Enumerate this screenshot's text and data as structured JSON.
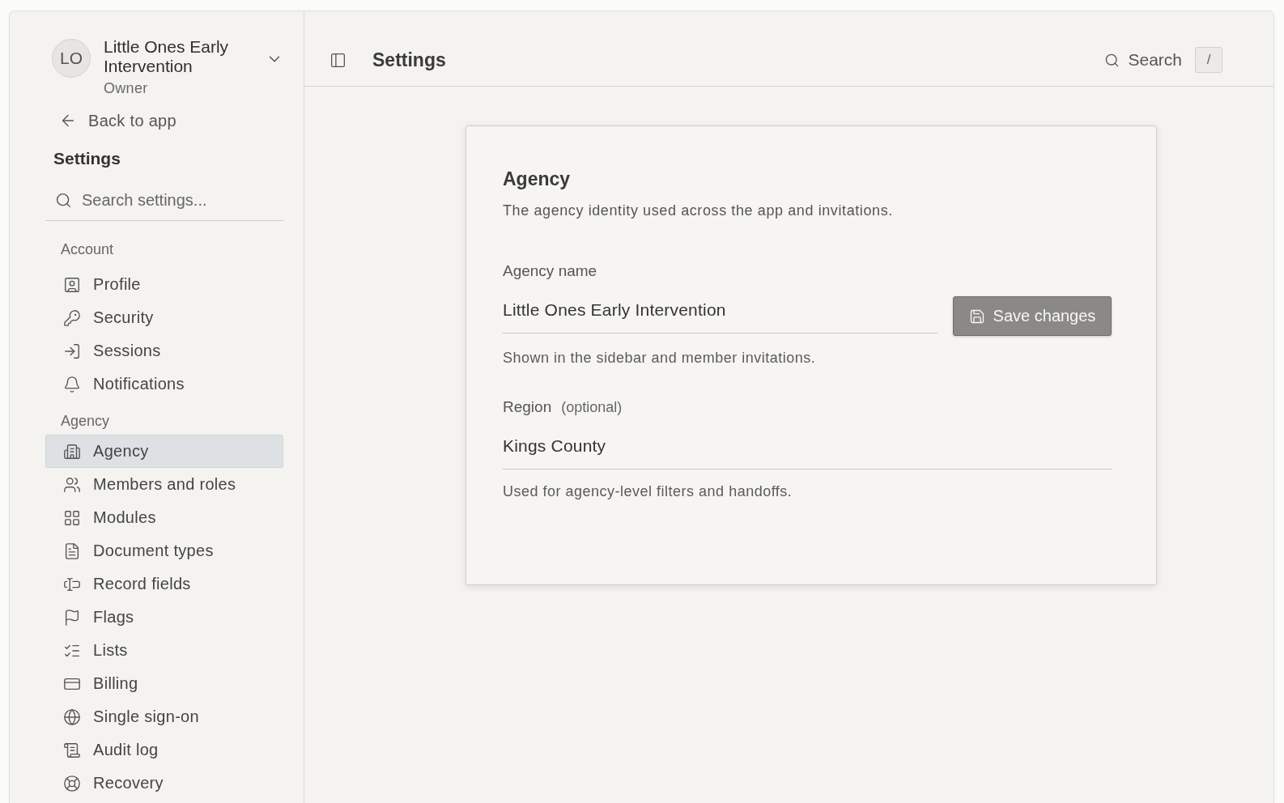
{
  "workspace": {
    "initials": "LO",
    "name": "Little Ones Early Intervention",
    "role": "Owner"
  },
  "back_link": "Back to app",
  "sidebar": {
    "title": "Settings",
    "search": {
      "placeholder": "Search settings..."
    },
    "groups": [
      {
        "label": "Account",
        "items": [
          {
            "label": "Profile",
            "selected": false
          },
          {
            "label": "Security",
            "selected": false
          },
          {
            "label": "Sessions",
            "selected": false
          },
          {
            "label": "Notifications",
            "selected": false
          }
        ]
      },
      {
        "label": "Agency",
        "items": [
          {
            "label": "Agency",
            "selected": true
          },
          {
            "label": "Members and roles",
            "selected": false
          },
          {
            "label": "Modules",
            "selected": false
          },
          {
            "label": "Document types",
            "selected": false
          },
          {
            "label": "Record fields",
            "selected": false
          },
          {
            "label": "Flags",
            "selected": false
          },
          {
            "label": "Lists",
            "selected": false
          },
          {
            "label": "Billing",
            "selected": false
          },
          {
            "label": "Single sign-on",
            "selected": false
          },
          {
            "label": "Audit log",
            "selected": false
          },
          {
            "label": "Recovery",
            "selected": false
          }
        ]
      }
    ]
  },
  "header": {
    "title": "Settings",
    "search_label": "Search",
    "shortcut": "/"
  },
  "card": {
    "title": "Agency",
    "description": "The agency identity used across the app and invitations.",
    "fields": [
      {
        "label": "Agency name",
        "value": "Little Ones Early Intervention",
        "help": "Shown in the sidebar and member invitations."
      },
      {
        "label": "Region",
        "optional": "(optional)",
        "value": "Kings County",
        "help": "Used for agency-level filters and handoffs."
      }
    ],
    "save_button": "Save changes"
  }
}
